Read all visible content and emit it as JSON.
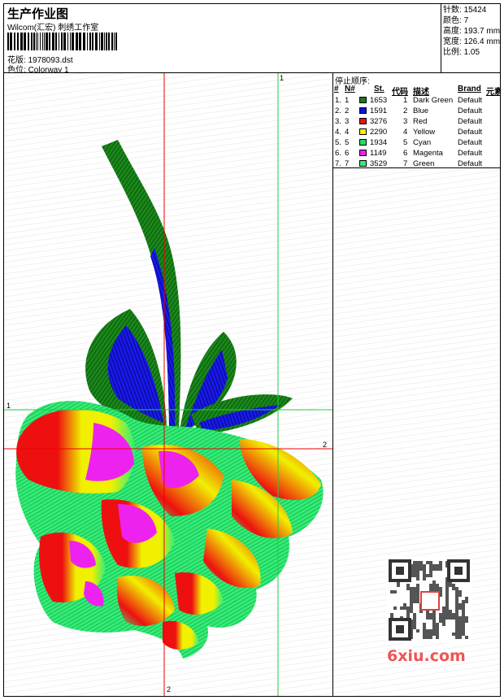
{
  "header": {
    "title": "生产作业图",
    "company": "Wilcom(汇宏) 刺绣工作室",
    "design_label": "花版:",
    "design_file": "1978093.dst",
    "colorway_label": "色位:",
    "colorway": "Colorway 1"
  },
  "stats": [
    {
      "label": "针数:",
      "value": "15424"
    },
    {
      "label": "颜色:",
      "value": "7"
    },
    {
      "label": "高度:",
      "value": "193.7 mm"
    },
    {
      "label": "宽度:",
      "value": "126.4 mm"
    },
    {
      "label": "比例:",
      "value": "1.05"
    }
  ],
  "stop_sequence": {
    "title": "停止顺序:",
    "columns": [
      "#",
      "N#",
      "St.",
      "代码",
      "描述",
      "Brand",
      "元素"
    ],
    "rows": [
      {
        "idx": "1.",
        "n": "1",
        "st": "1653",
        "code": "1",
        "desc": "Dark Green",
        "brand": "Default",
        "color": "#1a7a1a"
      },
      {
        "idx": "2.",
        "n": "2",
        "st": "1591",
        "code": "2",
        "desc": "Blue",
        "brand": "Default",
        "color": "#1010e0"
      },
      {
        "idx": "3.",
        "n": "3",
        "st": "3276",
        "code": "3",
        "desc": "Red",
        "brand": "Default",
        "color": "#ee1010"
      },
      {
        "idx": "4.",
        "n": "4",
        "st": "2290",
        "code": "4",
        "desc": "Yellow",
        "brand": "Default",
        "color": "#f0f000"
      },
      {
        "idx": "5.",
        "n": "5",
        "st": "1934",
        "code": "5",
        "desc": "Cyan",
        "brand": "Default",
        "color": "#22dd66"
      },
      {
        "idx": "6.",
        "n": "6",
        "st": "1149",
        "code": "6",
        "desc": "Magenta",
        "brand": "Default",
        "color": "#ee22ee"
      },
      {
        "idx": "7.",
        "n": "7",
        "st": "3529",
        "code": "7",
        "desc": "Green",
        "brand": "Default",
        "color": "#33ee77"
      }
    ]
  },
  "guides": {
    "v1": "1",
    "h1": "1",
    "h2": "2",
    "v2": "2"
  },
  "watermark_text": "6xiu.com"
}
